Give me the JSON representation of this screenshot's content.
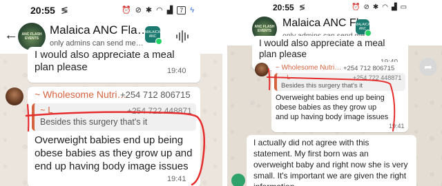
{
  "left": {
    "status_time": "20:55",
    "battery": "7",
    "group_name": "Malaica ANC Fla…",
    "group_sub": "only admins can send me…",
    "group_avatar_text": "ANC FLASH EVENTS",
    "app_icon_text": "MALAICA ANC",
    "msg1": {
      "line1": "I would also appreciate a meal",
      "line2": "plan please",
      "time": "19:40"
    },
    "msg2": {
      "sender": "~ Wholesome Nutri…",
      "phone": "+254 712 806715",
      "quote_name": "~ L",
      "quote_phone": "+254 722 448871",
      "quote_text": "Besides this surgery that's it",
      "lines": [
        "Overweight babies end up being",
        "obese babies as they grow up and",
        "end up having body image issues"
      ],
      "time": "19:41"
    }
  },
  "right": {
    "status_time": "20:55",
    "group_name": "Malaica ANC Fla",
    "group_sub": "only admins can send me…",
    "group_avatar_text": "ANC FLASH EVENTS",
    "app_icon_text": "MALAICA ANC",
    "msg1": {
      "line1": "I would also appreciate a meal",
      "line2": "plan please",
      "time": "19:40"
    },
    "msg2": {
      "sender": "~ Wholesome Nutri…",
      "phone": "+254 712 806715",
      "quote_name": "~ L",
      "quote_phone": "+254 722 448871",
      "quote_text": "Besides this surgery that's it",
      "lines": [
        "Overweight babies end up being",
        "obese babies as they grow up",
        "and up having body image issues"
      ],
      "time": "19:41"
    },
    "msg3": {
      "lines": [
        "I actually did not agree with this",
        "statement. My first born was an",
        "overweight baby and right now she is very",
        "small. It's important we are given the right",
        "information"
      ]
    }
  },
  "colors": {
    "annotation": "#e52b2b",
    "sender": "#d5633f",
    "whatsapp_green": "#25d366"
  },
  "icons": [
    "back-arrow-icon",
    "audio-wave-icon",
    "forward-icon",
    "alarm-icon",
    "bluetooth-icon",
    "wifi-icon",
    "signal-icon",
    "battery-icon"
  ]
}
